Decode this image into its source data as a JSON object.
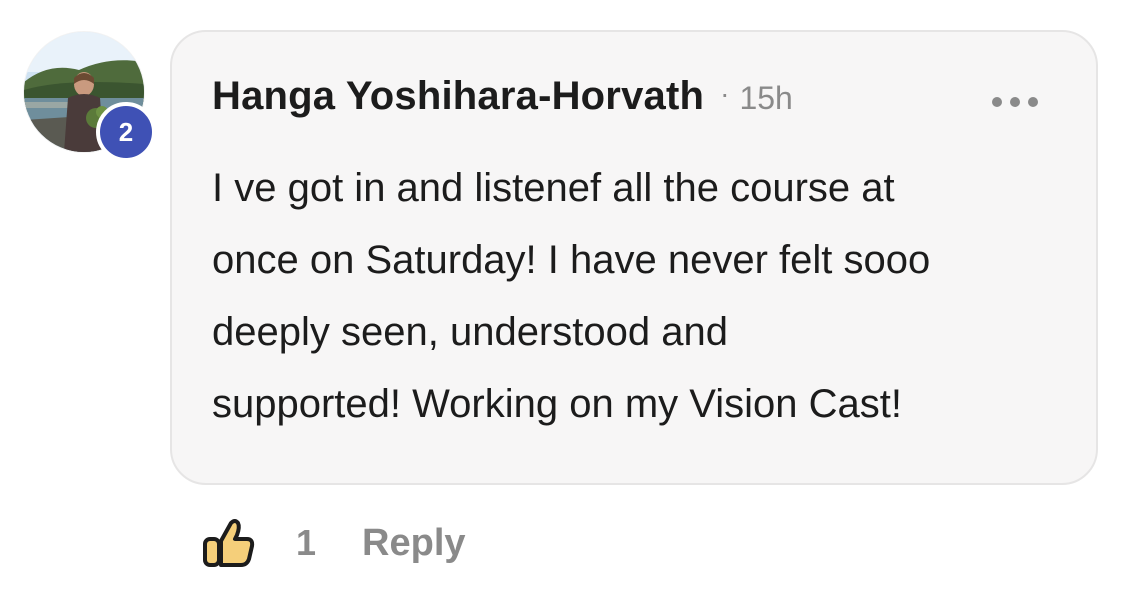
{
  "comment": {
    "author": "Hanga Yoshihara-Horvath",
    "separator": "·",
    "time": "15h",
    "text_lines": [
      "I ve got in and listenef all the course at",
      "once on Saturday! I have never felt sooo",
      "deeply seen, understood and",
      "supported! Working on my Vision Cast!"
    ]
  },
  "avatar": {
    "badge_count": "2",
    "badge_color": "#3f51b5"
  },
  "actions": {
    "like_icon": "thumbs-up-icon",
    "like_count": "1",
    "reply_label": "Reply",
    "more_icon": "more-options-icon"
  },
  "colors": {
    "bubble_background": "#f7f6f6",
    "text_primary": "#1c1c1c",
    "text_secondary": "#8a8a8a",
    "like_yellow": "#f5cf7a"
  }
}
